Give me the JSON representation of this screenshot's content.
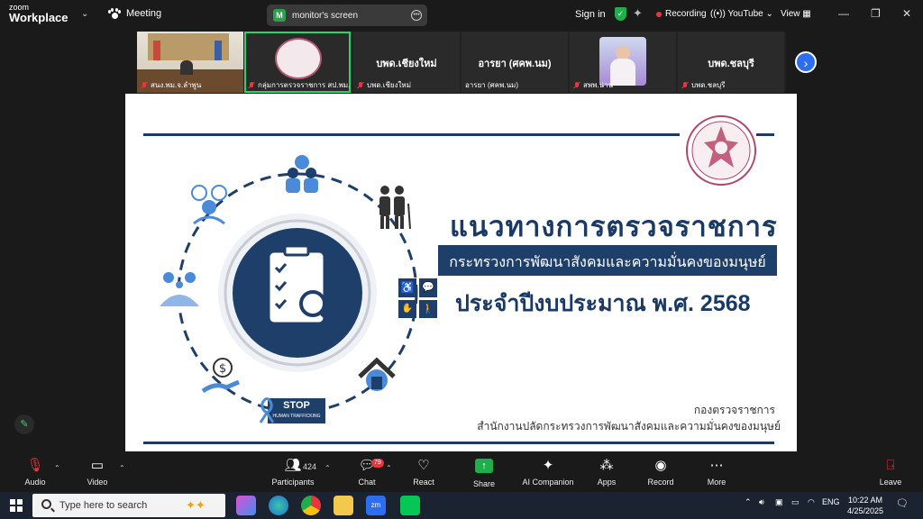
{
  "app": {
    "brand_small": "zoom",
    "brand_big": "Workplace",
    "meeting_label": "Meeting",
    "share_badge": "M",
    "share_title": "monitor's screen",
    "sign_in": "Sign in",
    "recording": "Recording",
    "youtube": "YouTube",
    "view": "View"
  },
  "participants": [
    {
      "name": "สนง.พม.จ.ลำพูน",
      "display": ""
    },
    {
      "name": "กลุ่มการตรวจราชการ สป.พม.",
      "display": ""
    },
    {
      "name": "บพด.เชียงใหม่",
      "display": "บพด.เชียงใหม่"
    },
    {
      "name": "อารยา (ศคพ.นม)",
      "display": "อารยา (ศคพ.นม)"
    },
    {
      "name": "สพพ.น่าน",
      "display": ""
    },
    {
      "name": "บพด.ชลบุรี",
      "display": "บพด.ชลบุรี"
    }
  ],
  "slide": {
    "title": "แนวทางการตรวจราชการ",
    "ministry": "กระทรวงการพัฒนาสังคมและความมั่นคงของมนุษย์",
    "year_line": "ประจำปีงบประมาณ พ.ศ. 2568",
    "org_line1": "กองตรวจราชการ",
    "org_line2": "สำนักงานปลัดกระทรวงการพัฒนาสังคมและความมั่นคงของมนุษย์",
    "stop_main": "STOP",
    "stop_sub": "HUMAN TRAFFICKING"
  },
  "toolbar": {
    "audio": "Audio",
    "video": "Video",
    "participants": "Participants",
    "participants_count": "424",
    "chat": "Chat",
    "chat_badge": "79",
    "react": "React",
    "share": "Share",
    "ai": "AI Companion",
    "apps": "Apps",
    "record": "Record",
    "more": "More",
    "leave": "Leave"
  },
  "taskbar": {
    "search_placeholder": "Type here to search",
    "lang": "ENG",
    "time": "10:22 AM",
    "date": "4/25/2025"
  },
  "colors": {
    "navy": "#1f3f6b",
    "green": "#1fae4b",
    "red": "#e8363d",
    "blue_btn": "#2d6ef0"
  }
}
